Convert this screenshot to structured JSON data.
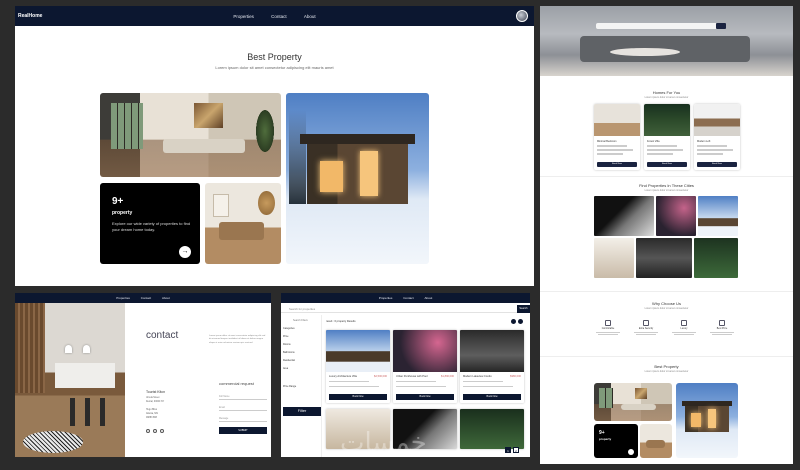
{
  "main": {
    "logo": "RealHome",
    "nav_links": [
      "Properties",
      "Contact",
      "About"
    ],
    "section_title": "Best Property",
    "section_subtitle": "Lorem ipsum dolor sit amet consectetur adipiscing elit mauris amet",
    "stat_number": "9+",
    "stat_label": "property",
    "stat_desc": "Explore our wide variety of properties to find your dream home today.",
    "arrow_glyph": "→"
  },
  "right_page": {
    "homes_for_you": "Homes For You",
    "homes_sub": "Lorem ipsum dolor sit amet consectetur",
    "cards": [
      {
        "title": "Minimal Bedroom",
        "btn": "Book Now"
      },
      {
        "title": "Forest Villa",
        "btn": "Book Now"
      },
      {
        "title": "Modern Loft",
        "btn": "Book Now"
      }
    ],
    "cities_title": "Find Properties In These Cities",
    "cities_sub": "Lorem ipsum dolor sit amet consectetur",
    "why_title": "Why Choose Us",
    "why_sub": "Lorem ipsum dolor sit amet consectetur",
    "why_items": [
      "Comfortable",
      "Extra Security",
      "Luxury",
      "Best Price"
    ],
    "best_title": "Best Property",
    "best_sub": "Lorem ipsum dolor sit amet consectetur",
    "stat_number": "9+",
    "stat_label": "property"
  },
  "contact": {
    "nav_links": [
      "Properties",
      "Contact",
      "About"
    ],
    "title": "contact",
    "paragraph": "Lorem ipsum dolor sit amet consectetur adipiscing elit sed do eiusmod tempor incididunt ut labore et dolore magna aliqua ut enim ad minim veniam quis nostrud.",
    "office_title": "Tourist Kitcn",
    "office_lines": [
      "Ursula Street",
      "Dental, 00000 NY",
      "Hugo Bliss",
      "Atlanta, MN",
      "09883 888"
    ],
    "form_title": "commercial request",
    "fields": [
      "Full Name",
      "Email",
      "Message"
    ],
    "submit": "SUBMIT"
  },
  "listings": {
    "nav_links": [
      "Properties",
      "Contact",
      "About"
    ],
    "search_placeholder": "Search for properties",
    "search_btn": "Search",
    "sidebar_title": "Search Filters",
    "sidebar_items": [
      "Categories",
      "Price",
      "Rooms",
      "Bathrooms",
      "Residential",
      "Area",
      "Price Range"
    ],
    "filter_btn": "Filter",
    "result_count": "result : 6 property Results",
    "cards": [
      {
        "title": "Luxury Architecture Villa",
        "price": "$2,500,000",
        "btn": "Book Now"
      },
      {
        "title": "Urban Penthouse with Pool",
        "price": "$1,890,000",
        "btn": "Book Now"
      },
      {
        "title": "Modern Lakeview Condo",
        "price": "$980,000",
        "btn": "Book Now"
      }
    ],
    "pages": [
      "1",
      "2"
    ]
  },
  "watermark": "خمسات"
}
